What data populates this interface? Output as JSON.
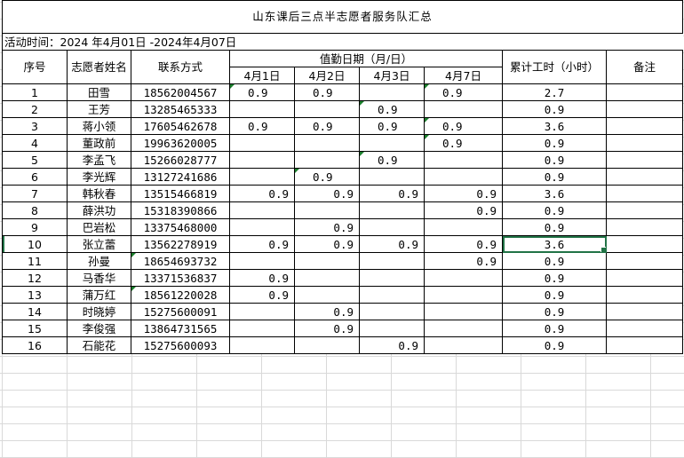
{
  "title": "山东课后三点半志愿者服务队汇总",
  "period": "活动时间：2024 年4月01日  -2024年4月07日",
  "headers": {
    "index": "序号",
    "name": "志愿者姓名",
    "contact": "联系方式",
    "duty_dates": "值勤日期（月/日）",
    "dates": [
      "4月1日",
      "4月2日",
      "4月3日",
      "4月7日"
    ],
    "total": "累计工时（小时）",
    "remarks": "备注"
  },
  "rows": [
    {
      "no": "1",
      "name": "田雪",
      "phone": "18562004567",
      "d1": "0.9",
      "d2": "0.9",
      "d3": "",
      "d4": "0.9",
      "total": "2.7"
    },
    {
      "no": "2",
      "name": "王芳",
      "phone": "13285465333",
      "d1": "",
      "d2": "",
      "d3": "0.9",
      "d4": "",
      "total": "0.9"
    },
    {
      "no": "3",
      "name": "蒋小领",
      "phone": "17605462678",
      "d1": "0.9",
      "d2": "0.9",
      "d3": "0.9",
      "d4": "0.9",
      "total": "3.6"
    },
    {
      "no": "4",
      "name": "董政前",
      "phone": "19963620005",
      "d1": "",
      "d2": "",
      "d3": "",
      "d4": "0.9",
      "total": "0.9"
    },
    {
      "no": "5",
      "name": "李孟飞",
      "phone": "15266028777",
      "d1": "",
      "d2": "",
      "d3": "0.9",
      "d4": "",
      "total": "0.9"
    },
    {
      "no": "6",
      "name": "李光辉",
      "phone": "13127241686",
      "d1": "",
      "d2": "0.9",
      "d3": "",
      "d4": "",
      "total": "0.9"
    },
    {
      "no": "7",
      "name": "韩秋春",
      "phone": "13515466819",
      "d1": "0.9",
      "d2": "0.9",
      "d3": "0.9",
      "d4": "0.9",
      "total": "3.6"
    },
    {
      "no": "8",
      "name": "薛洪功",
      "phone": "15318390866",
      "d1": "",
      "d2": "",
      "d3": "",
      "d4": "0.9",
      "total": "0.9"
    },
    {
      "no": "9",
      "name": "巴岩松",
      "phone": "13375468000",
      "d1": "",
      "d2": "0.9",
      "d3": "",
      "d4": "",
      "total": "0.9"
    },
    {
      "no": "10",
      "name": "张立蕾",
      "phone": "13562278919",
      "d1": "0.9",
      "d2": "0.9",
      "d3": "0.9",
      "d4": "0.9",
      "total": "3.6"
    },
    {
      "no": "11",
      "name": "孙曼",
      "phone": "18654693732",
      "d1": "",
      "d2": "",
      "d3": "",
      "d4": "0.9",
      "total": "0.9"
    },
    {
      "no": "12",
      "name": "马香华",
      "phone": "13371536837",
      "d1": "0.9",
      "d2": "",
      "d3": "",
      "d4": "",
      "total": "0.9"
    },
    {
      "no": "13",
      "name": "蒲万红",
      "phone": "18561220028",
      "d1": "0.9",
      "d2": "",
      "d3": "",
      "d4": "",
      "total": "0.9"
    },
    {
      "no": "14",
      "name": "时晓婷",
      "phone": "15275600091",
      "d1": "",
      "d2": "0.9",
      "d3": "",
      "d4": "",
      "total": "0.9"
    },
    {
      "no": "15",
      "name": "李俊强",
      "phone": "13864731565",
      "d1": "",
      "d2": "0.9",
      "d3": "",
      "d4": "",
      "total": "0.9"
    },
    {
      "no": "16",
      "name": "石能花",
      "phone": "15275600093",
      "d1": "",
      "d2": "",
      "d3": "0.9",
      "d4": "",
      "total": "0.9"
    }
  ],
  "selected_cell": "row 10 total",
  "colors": {
    "selection": "#217346",
    "comment_marker": "#1a7f2c",
    "gridline": "#d9d9d9"
  }
}
